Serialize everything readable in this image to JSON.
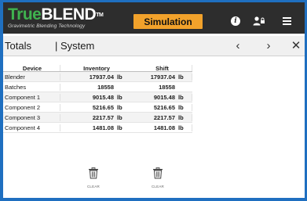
{
  "header": {
    "logo_true": "True",
    "logo_blend": "BLEND",
    "logo_tm": "TM",
    "logo_subtitle": "Gravimetric Blending Technology",
    "mode_badge": "Simulation",
    "accent_color": "#1f6fc0",
    "badge_color": "#f2a22b",
    "icons": [
      "info-icon",
      "user-lock-icon",
      "menu-icon"
    ]
  },
  "subheader": {
    "title": "Totals",
    "section": "| System",
    "prev_label": "‹",
    "next_label": "›",
    "close_label": "✕"
  },
  "table": {
    "headers": {
      "device": "Device",
      "inventory": "Inventory",
      "shift": "Shift"
    },
    "rows": [
      {
        "device": "Blender",
        "inventory": "17937.04",
        "inv_unit": "lb",
        "shift": "17937.04",
        "shift_unit": "lb"
      },
      {
        "device": "Batches",
        "inventory": "18558",
        "inv_unit": "",
        "shift": "18558",
        "shift_unit": ""
      },
      {
        "device": "Component 1",
        "inventory": "9015.48",
        "inv_unit": "lb",
        "shift": "9015.48",
        "shift_unit": "lb"
      },
      {
        "device": "Component 2",
        "inventory": "5216.65",
        "inv_unit": "lb",
        "shift": "5216.65",
        "shift_unit": "lb"
      },
      {
        "device": "Component 3",
        "inventory": "2217.57",
        "inv_unit": "lb",
        "shift": "2217.57",
        "shift_unit": "lb"
      },
      {
        "device": "Component 4",
        "inventory": "1481.08",
        "inv_unit": "lb",
        "shift": "1481.08",
        "shift_unit": "lb"
      }
    ]
  },
  "actions": {
    "clear_inventory_label": "CLEAR",
    "clear_shift_label": "CLEAR"
  }
}
